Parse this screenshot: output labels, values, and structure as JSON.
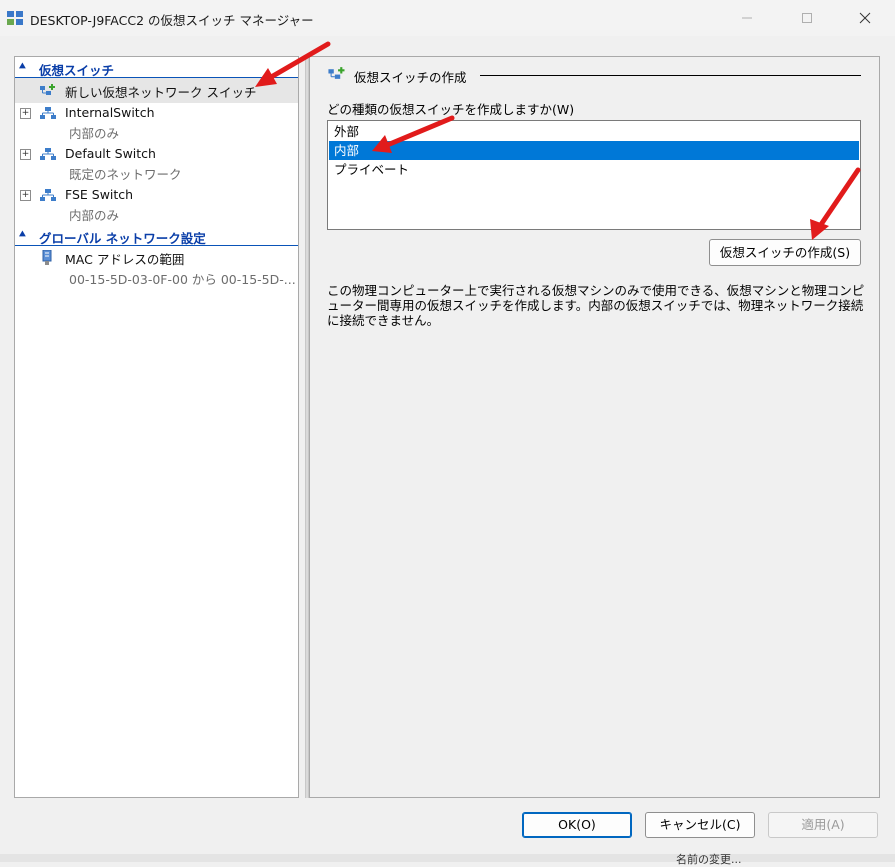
{
  "window": {
    "title": "DESKTOP-J9FACC2 の仮想スイッチ マネージャー",
    "controls": [
      "minimize",
      "maximize",
      "close"
    ]
  },
  "left_pane": {
    "section_switches": "仮想スイッチ",
    "section_global": "グローバル ネットワーク設定",
    "items": [
      {
        "label": "新しい仮想ネットワーク スイッチ",
        "icon": "new-switch-icon",
        "selected": true
      },
      {
        "label": "InternalSwitch",
        "sub": "内部のみ",
        "icon": "network-switch-icon"
      },
      {
        "label": "Default Switch",
        "sub": "既定のネットワーク",
        "icon": "network-switch-icon"
      },
      {
        "label": "FSE Switch",
        "sub": "内部のみ",
        "icon": "network-switch-icon"
      }
    ],
    "global_items": [
      {
        "label": "MAC アドレスの範囲",
        "sub": "00-15-5D-03-0F-00 から 00-15-5D-...",
        "icon": "adapter-icon"
      }
    ]
  },
  "right_pane": {
    "group_title": "仮想スイッチの作成",
    "question": "どの種類の仮想スイッチを作成しますか(W)",
    "options": [
      "外部",
      "内部",
      "プライベート"
    ],
    "selected_option": "内部",
    "create_button": "仮想スイッチの作成(S)",
    "description": "この物理コンピューター上で実行される仮想マシンのみで使用できる、仮想マシンと物理コンピューター間専用の仮想スイッチを作成します。内部の仮想スイッチでは、物理ネットワーク接続に接続できません。"
  },
  "footer": {
    "ok": "OK(O)",
    "cancel": "キャンセル(C)",
    "apply": "適用(A)"
  },
  "background": {
    "partial_text": "名前の変更..."
  },
  "colors": {
    "section_head": "#0a3ea8",
    "selection": "#0078d7",
    "annotation_arrow": "#e11b1b"
  }
}
